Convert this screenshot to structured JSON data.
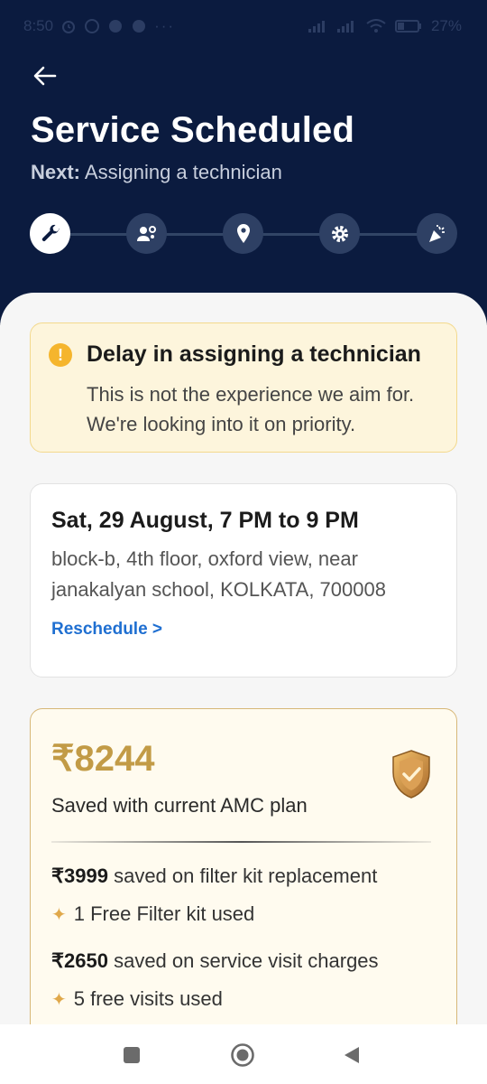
{
  "status_bar": {
    "time": "8:50",
    "battery": "27%"
  },
  "header": {
    "title": "Service Scheduled",
    "next_label": "Next:",
    "next_value": "Assigning a technician"
  },
  "steps": [
    {
      "icon": "wrench-icon",
      "active": true
    },
    {
      "icon": "technician-icon",
      "active": false
    },
    {
      "icon": "location-pin-icon",
      "active": false
    },
    {
      "icon": "gear-icon",
      "active": false
    },
    {
      "icon": "party-popper-icon",
      "active": false
    }
  ],
  "alert": {
    "title": "Delay in assigning a technician",
    "message": "This is not the experience we aim for. We're looking into it on priority."
  },
  "slot": {
    "date_time": "Sat, 29 August, 7 PM to 9 PM",
    "address": "block-b, 4th floor, oxford view, near janakalyan school, KOLKATA, 700008",
    "reschedule_label": "Reschedule >"
  },
  "amc": {
    "amount": "₹8244",
    "caption": "Saved with current AMC plan",
    "savings": [
      {
        "amount": "₹3999",
        "text": "saved on filter kit replacement",
        "perk": "1 Free Filter kit used"
      },
      {
        "amount": "₹2650",
        "text": "saved on service visit charges",
        "perk": "5 free visits used"
      }
    ]
  },
  "colors": {
    "header_bg": "#0b1b3f",
    "accent_link": "#1f6fd1",
    "alert_bg": "#fdf5dc",
    "gold": "#c29b46"
  }
}
